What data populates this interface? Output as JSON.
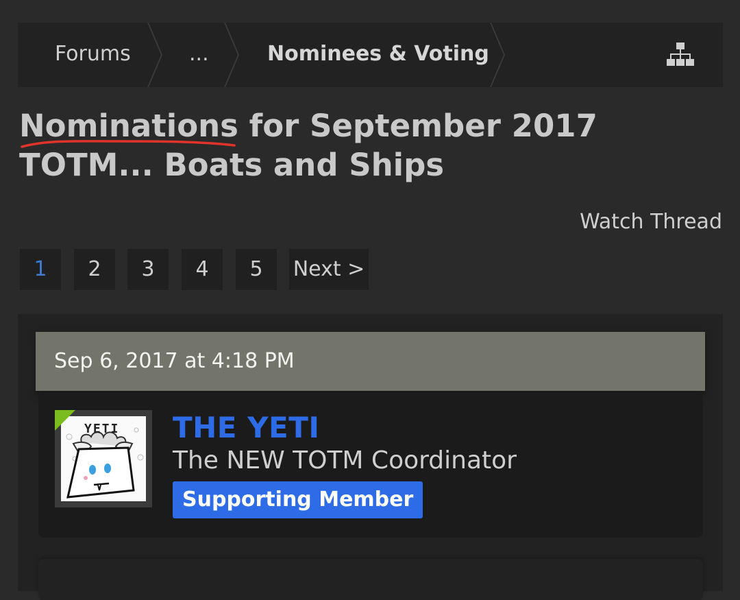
{
  "breadcrumb": {
    "items": [
      {
        "label": "Forums"
      },
      {
        "label": "..."
      },
      {
        "label": "Nominees & Voting"
      }
    ],
    "sitemap_icon": "sitemap-icon"
  },
  "thread": {
    "title": "Nominations for September 2017 TOTM... Boats and Ships",
    "watch_label": "Watch Thread"
  },
  "pagination": {
    "pages": [
      "1",
      "2",
      "3",
      "4",
      "5"
    ],
    "current": "1",
    "next_label": "Next >"
  },
  "post": {
    "date": "Sep 6, 2017 at 4:18 PM",
    "user": {
      "name": "THE YETI",
      "title": "The NEW TOTM Coordinator",
      "banner": "Supporting Member",
      "avatar_text": "YETI",
      "online": true
    }
  },
  "colors": {
    "background": "#2a2a2a",
    "panel": "#222222",
    "accent": "#2d6ce6",
    "current_page": "#3e7bd1",
    "date_bar": "#74756a",
    "online": "#7bbd1f",
    "spellcheck": "#e0342a"
  }
}
